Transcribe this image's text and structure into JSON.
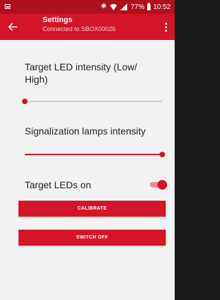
{
  "status_bar": {
    "battery": "77%",
    "time": "10:52"
  },
  "app_bar": {
    "title": "Settings",
    "subtitle": "Connected to SBOX00026"
  },
  "settings": {
    "target_led_intensity": {
      "label": "Target LED intensity (Low/ High)",
      "value": 0.0
    },
    "signalization_lamps_intensity": {
      "label": "Signalization lamps intensity",
      "value": 1.0
    },
    "target_leds_on": {
      "label": "Target LEDs on",
      "checked": true
    }
  },
  "buttons": {
    "calibrate": "CALIBRATE",
    "switch_off": "SWITCH OFF"
  },
  "colors": {
    "accent": "#d31527",
    "status_bar": "#b0101e",
    "background": "#f2f2f2"
  }
}
